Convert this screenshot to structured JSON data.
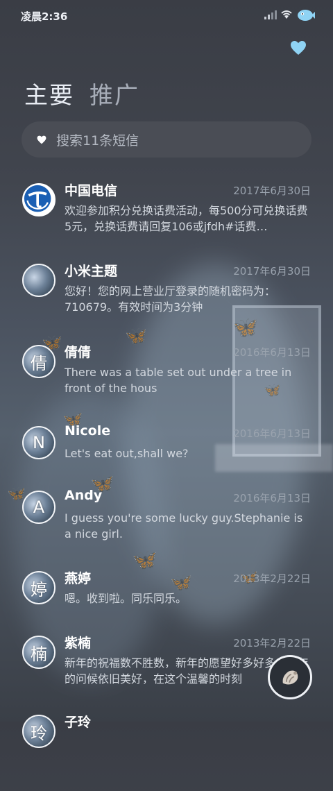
{
  "status_bar": {
    "time": "凌晨2:36"
  },
  "tabs": [
    {
      "label": "主要"
    },
    {
      "label": "推广"
    }
  ],
  "search": {
    "placeholder": "搜索11条短信"
  },
  "messages": [
    {
      "name": "中国电信",
      "date": "2017年6月30日",
      "preview": "欢迎参加积分兑换话费活动，每500分可兑换话费5元，兑换话费请回复106或jfdh#话费…"
    },
    {
      "name": "小米主题",
      "date": "2017年6月30日",
      "preview": "您好！您的网上营业厅登录的随机密码为：710679。有效时间为3分钟"
    },
    {
      "name": "倩倩",
      "date": "2016年6月13日",
      "preview": "There was a table set out under a tree in front of the hous",
      "avatar_text": "倩"
    },
    {
      "name": "Nicole",
      "date": "2016年6月13日",
      "preview": "Let's eat out,shall we?",
      "avatar_text": "N"
    },
    {
      "name": "Andy",
      "date": "2016年6月13日",
      "preview": "I guess you're some lucky guy.Stephanie is a nice girl.",
      "avatar_text": "A"
    },
    {
      "name": "燕婷",
      "date": "2013年2月22日",
      "preview": "嗯。收到啦。同乐同乐。",
      "avatar_text": "婷"
    },
    {
      "name": "紫楠",
      "date": "2013年2月22日",
      "preview": "新年的祝福数不胜数，新年的愿望好多好多，新年的问候依旧美好，在这个温馨的时刻",
      "avatar_text": "楠"
    },
    {
      "name": "子玲",
      "date": "",
      "preview": "",
      "avatar_text": "玲"
    }
  ],
  "icons": {
    "signal": "signal-icon",
    "wifi": "wifi-icon",
    "status_app": "fish-icon",
    "heart": "heart-icon",
    "fab": "shell-icon"
  },
  "colors": {
    "accent_heart": "#8fd3f4",
    "background": "#41454e"
  }
}
